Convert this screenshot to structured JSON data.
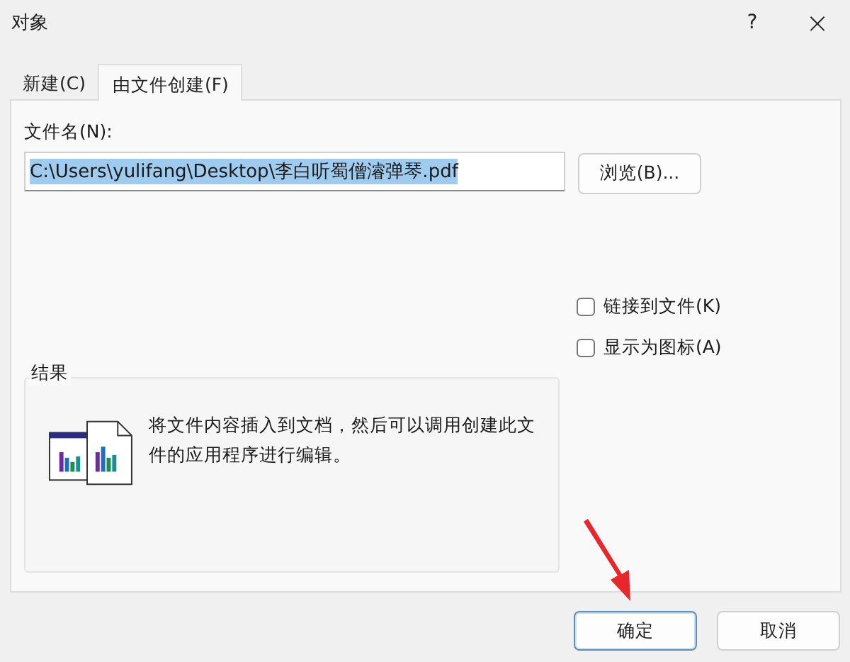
{
  "window": {
    "title": "对象",
    "help": "?",
    "close": "×"
  },
  "tabs": [
    {
      "label": "新建(C)",
      "selected": false
    },
    {
      "label": "由文件创建(F)",
      "selected": true
    }
  ],
  "file_name": {
    "label": "文件名(N):",
    "value": "C:\\Users\\yulifang\\Desktop\\李白听蜀僧濬弹琴.pdf",
    "text_selected": true
  },
  "browse_button": "浏览(B)...",
  "options": [
    {
      "label": "链接到文件(K)",
      "checked": false
    },
    {
      "label": "显示为图标(A)",
      "checked": false
    }
  ],
  "result": {
    "title": "结果",
    "description": "将文件内容插入到文档，然后可以调用创建此文件的应用程序进行编辑。"
  },
  "buttons": [
    {
      "label": "确定",
      "default": true
    },
    {
      "label": "取消",
      "default": false
    }
  ]
}
